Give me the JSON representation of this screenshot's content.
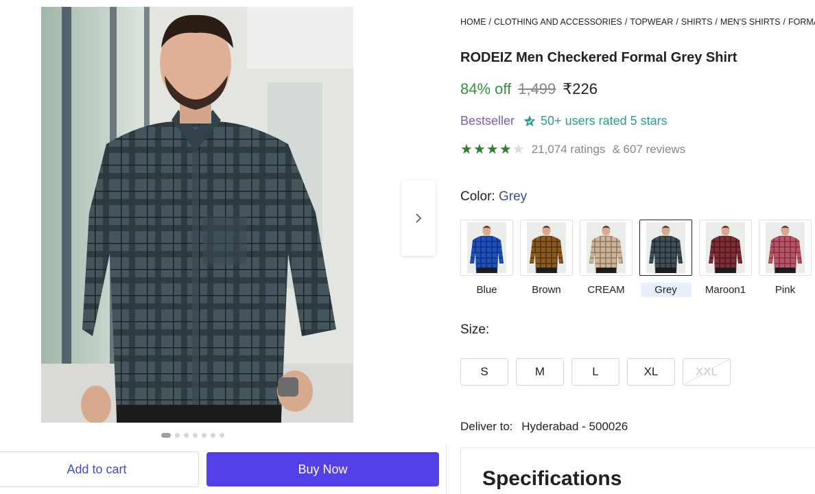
{
  "breadcrumb": [
    "HOME",
    "CLOTHING AND ACCESSORIES",
    "TOPWEAR",
    "SHIRTS",
    "MEN'S SHIRTS",
    "FORMA"
  ],
  "product": {
    "title": "RODEIZ Men Checkered Formal Grey Shirt",
    "discount": "84% off",
    "mrp": "1,499",
    "price": "₹226",
    "bestseller": "Bestseller",
    "users_rated": "50+ users rated 5 stars",
    "rating_stars": 4,
    "ratings": "21,074 ratings",
    "reviews": "& 607 reviews"
  },
  "color": {
    "label": "Color:",
    "selected": "Grey",
    "options": [
      {
        "name": "Blue",
        "shirt_color": "#1e4fb8",
        "check_color": "#0d2f80"
      },
      {
        "name": "Brown",
        "shirt_color": "#8a5a1e",
        "check_color": "#4a2f0c"
      },
      {
        "name": "CREAM",
        "shirt_color": "#c9b49a",
        "check_color": "#8a6f56"
      },
      {
        "name": "Grey",
        "shirt_color": "#3f4f57",
        "check_color": "#1d262b"
      },
      {
        "name": "Maroon1",
        "shirt_color": "#7e2e35",
        "check_color": "#4a1419"
      },
      {
        "name": "Pink",
        "shirt_color": "#b85668",
        "check_color": "#7a2c3c"
      }
    ]
  },
  "size": {
    "label": "Size:",
    "options": [
      {
        "name": "S",
        "available": true
      },
      {
        "name": "M",
        "available": true
      },
      {
        "name": "L",
        "available": true
      },
      {
        "name": "XL",
        "available": true
      },
      {
        "name": "XXL",
        "available": false
      }
    ]
  },
  "delivery": {
    "label": "Deliver to:",
    "location": "Hyderabad - 500026"
  },
  "specifications": {
    "title": "Specifications"
  },
  "actions": {
    "add_to_cart": "Add to cart",
    "buy_now": "Buy Now"
  },
  "gallery": {
    "image_count": 7,
    "active_index": 0
  },
  "colors": {
    "accent": "#5340e8",
    "discount": "#388e3c",
    "star": "#2e7d32",
    "bestseller": "#7b5ea8",
    "rated": "#2a9d8f"
  }
}
